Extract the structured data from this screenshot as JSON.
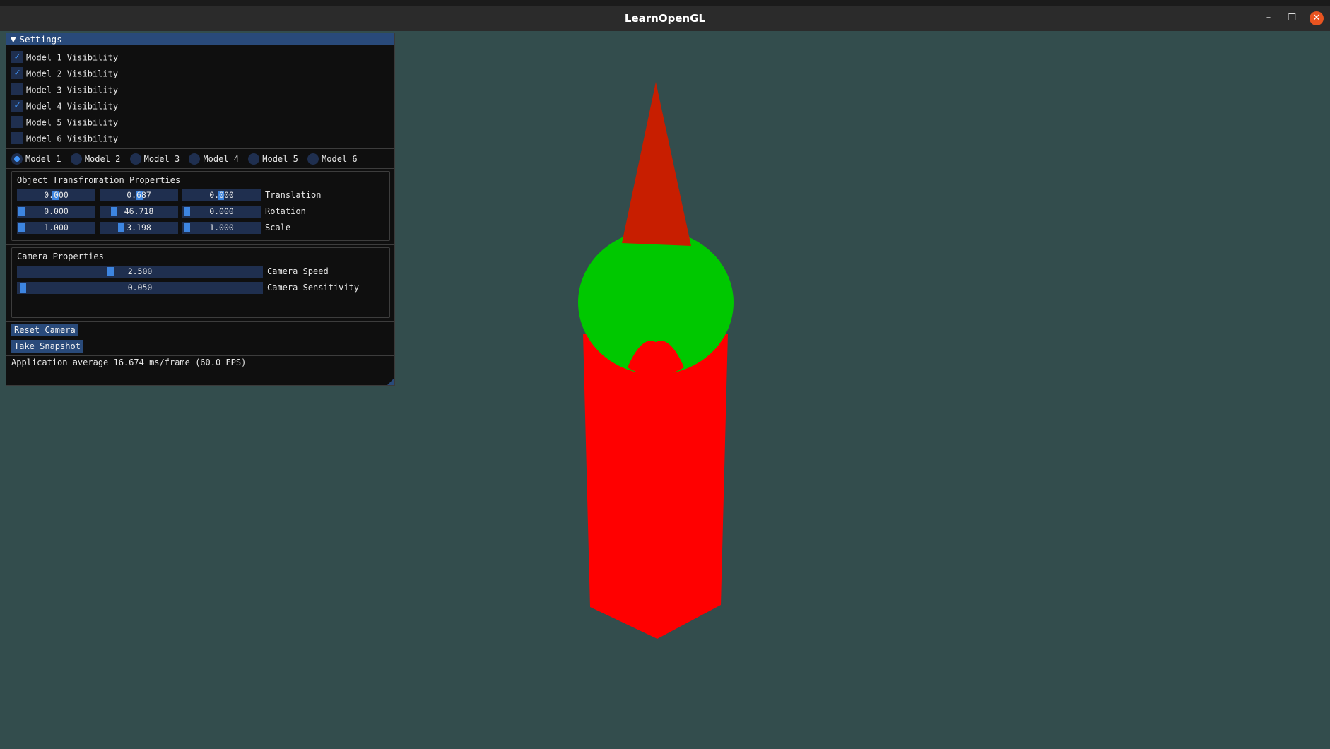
{
  "window": {
    "title": "LearnOpenGL",
    "controls": {
      "minimize": "–",
      "maximize": "❐",
      "close": "✕"
    }
  },
  "settings": {
    "title": "Settings",
    "visibility": [
      {
        "label": "Model 1 Visibility",
        "checked": true
      },
      {
        "label": "Model 2 Visibility",
        "checked": true
      },
      {
        "label": "Model 3 Visibility",
        "checked": false
      },
      {
        "label": "Model 4 Visibility",
        "checked": true
      },
      {
        "label": "Model 5 Visibility",
        "checked": false
      },
      {
        "label": "Model 6 Visibility",
        "checked": false
      }
    ],
    "models": [
      "Model 1",
      "Model 2",
      "Model 3",
      "Model 4",
      "Model 5",
      "Model 6"
    ],
    "selected_model": "Model 1",
    "transform": {
      "title": "Object Transfromation Properties",
      "rows": [
        {
          "label": "Translation",
          "values": [
            "0.000",
            "0.687",
            "0.000"
          ]
        },
        {
          "label": "Rotation",
          "values": [
            "0.000",
            "46.718",
            "0.000"
          ]
        },
        {
          "label": "Scale",
          "values": [
            "1.000",
            "3.198",
            "1.000"
          ]
        }
      ]
    },
    "camera": {
      "title": "Camera Properties",
      "speed": {
        "label": "Camera Speed",
        "value": "2.500"
      },
      "sensitivity": {
        "label": "Camera Sensitivity",
        "value": "0.050"
      }
    },
    "buttons": {
      "reset": "Reset Camera",
      "snapshot": "Take Snapshot"
    },
    "status": "Application average 16.674 ms/frame (60.0 FPS)"
  },
  "scene": {
    "background": "#334d4d",
    "colors": {
      "body": "#ff0000",
      "head": "#00c800",
      "cone": "#c81e00"
    }
  }
}
